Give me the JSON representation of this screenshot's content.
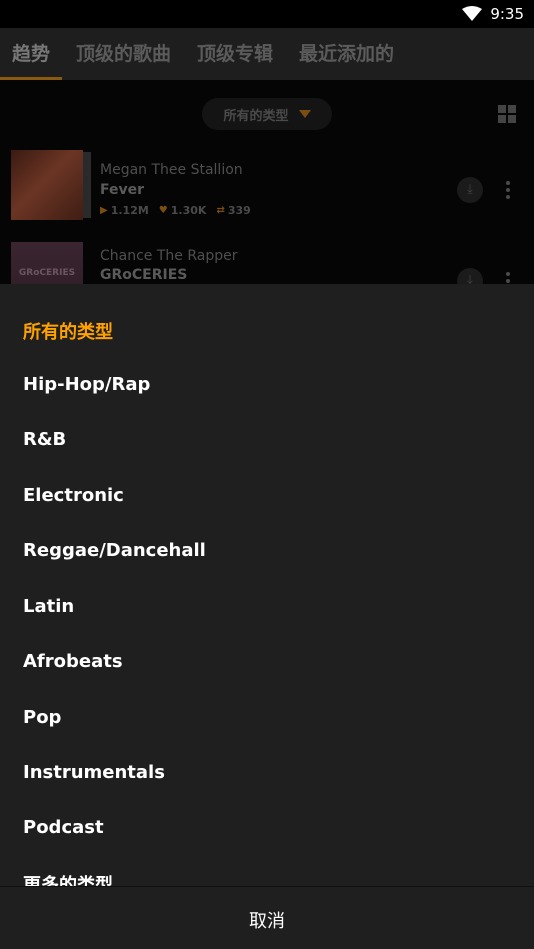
{
  "status_bar": {
    "time": "9:35",
    "icons": [
      "wifi-icon",
      "battery-icon"
    ]
  },
  "tabs": [
    {
      "label": "趋势",
      "active": true
    },
    {
      "label": "顶级的歌曲",
      "active": false
    },
    {
      "label": "顶级专辑",
      "active": false
    },
    {
      "label": "最近添加的",
      "active": false
    }
  ],
  "filter": {
    "genre_label": "所有的类型",
    "caret_icon": "caret-down-icon",
    "view_icon": "grid-view-icon"
  },
  "tracks": [
    {
      "artist": "Megan Thee Stallion",
      "title": "Fever",
      "plays": "1.12M",
      "likes": "1.30K",
      "reposts": "339",
      "cover_icon": "album-cover-fever"
    },
    {
      "artist": "Chance The Rapper",
      "title": "GRoCERIES",
      "cover_text": "GRoCERIES",
      "cover_icon": "album-cover-groceries"
    }
  ],
  "sheet": {
    "options": [
      {
        "label": "所有的类型",
        "selected": true
      },
      {
        "label": "Hip-Hop/Rap",
        "selected": false
      },
      {
        "label": "R&B",
        "selected": false
      },
      {
        "label": "Electronic",
        "selected": false
      },
      {
        "label": "Reggae/Dancehall",
        "selected": false
      },
      {
        "label": "Latin",
        "selected": false
      },
      {
        "label": "Afrobeats",
        "selected": false
      },
      {
        "label": "Pop",
        "selected": false
      },
      {
        "label": "Instrumentals",
        "selected": false
      },
      {
        "label": "Podcast",
        "selected": false
      },
      {
        "label": "更多的类型",
        "selected": false
      }
    ],
    "cancel_label": "取消"
  },
  "colors": {
    "accent": "#ffa200",
    "sheet_bg": "#1f1f1f"
  }
}
